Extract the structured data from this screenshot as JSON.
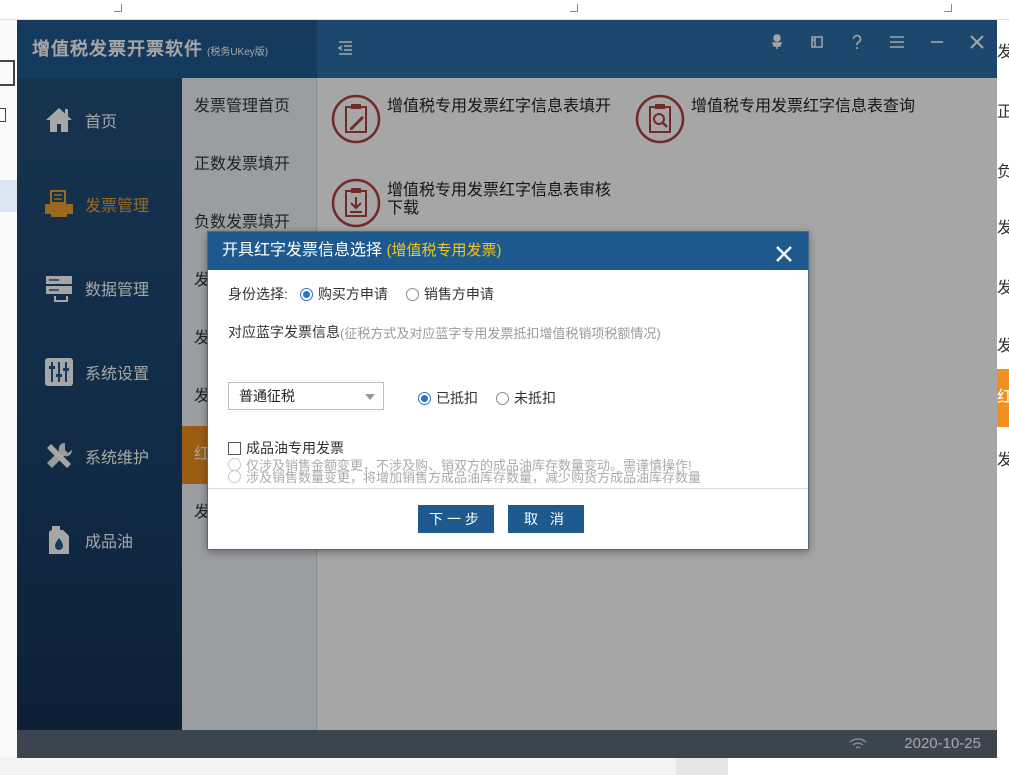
{
  "app": {
    "title": "增值税发票开票软件",
    "title_sub": "(税务UKey版)",
    "date": "2020-10-25"
  },
  "sidebar": {
    "items": [
      {
        "label": "首页",
        "icon": "home-icon"
      },
      {
        "label": "发票管理",
        "icon": "printer-icon",
        "active": true
      },
      {
        "label": "数据管理",
        "icon": "database-icon"
      },
      {
        "label": "系统设置",
        "icon": "sliders-icon"
      },
      {
        "label": "系统维护",
        "icon": "tools-icon"
      },
      {
        "label": "成品油",
        "icon": "oil-can-icon"
      }
    ]
  },
  "subnav": {
    "items": [
      {
        "label": "发票管理首页"
      },
      {
        "label": "正数发票填开"
      },
      {
        "label": "负数发票填开"
      },
      {
        "label": "发"
      },
      {
        "label": "发"
      },
      {
        "label": "发"
      },
      {
        "label": "红"
      },
      {
        "label": "发"
      }
    ]
  },
  "content": {
    "tiles": [
      {
        "label": "增值税专用发票红字信息表填开"
      },
      {
        "label": "增值税专用发票红字信息表查询"
      },
      {
        "label": "增值税专用发票红字信息表审核下载"
      }
    ]
  },
  "background": {
    "right_items": [
      "发",
      "正",
      "负",
      "发",
      "发",
      "发",
      "红",
      "发"
    ]
  },
  "dialog": {
    "title": "开具红字发票信息选择",
    "title_accent": "(增值税专用发票)",
    "identity_label": "身份选择:",
    "identity_options": [
      "购买方申请",
      "销售方申请"
    ],
    "blue_info_label": "对应蓝字发票信息",
    "blue_info_hint": "(征税方式及对应蓝字专用发票抵扣增值税销项税额情况)",
    "tax_method": "普通征税",
    "deduct_options": [
      "已抵扣",
      "未抵扣"
    ],
    "oil_checkbox_label": "成品油专用发票",
    "oil_options": [
      "涉及销售数量变更，将增加销售方成品油库存数量，减少购货方成品油库存数量",
      "仅涉及销售金额变更，不涉及购、销双方的成品油库存数量变动。需谨慎操作!"
    ],
    "next_label": "下一步",
    "cancel_label": "取 消"
  },
  "colors": {
    "titlebar": "#2b6fa8",
    "brand": "#1f5a8f",
    "accent_orange": "#f0901e",
    "dialog_accent": "#f5c518"
  }
}
